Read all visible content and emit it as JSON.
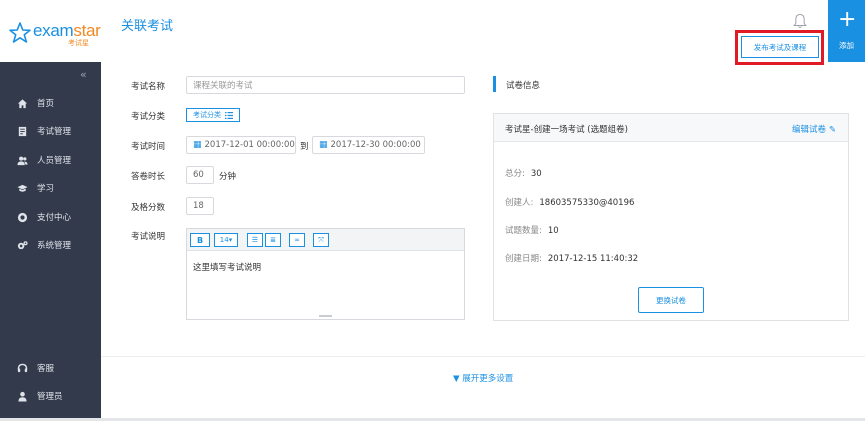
{
  "brand": {
    "name_a": "exam",
    "name_b": "star",
    "sub": "考试星"
  },
  "header": {
    "title": "关联考试",
    "publish_button": "发布考试及课程",
    "add_label": "添加",
    "add_symbol": "+"
  },
  "sidebar": {
    "collapse": "«",
    "items": [
      {
        "label": "首页",
        "icon": "home-icon"
      },
      {
        "label": "考试管理",
        "icon": "document-icon"
      },
      {
        "label": "人员管理",
        "icon": "users-icon"
      },
      {
        "label": "学习",
        "icon": "graduation-cap-icon"
      },
      {
        "label": "支付中心",
        "icon": "payment-icon"
      },
      {
        "label": "系统管理",
        "icon": "gears-icon"
      }
    ],
    "bottom": [
      {
        "label": "客服",
        "icon": "headset-icon"
      },
      {
        "label": "管理员",
        "icon": "user-icon"
      }
    ]
  },
  "form": {
    "name_label": "考试名称",
    "name_placeholder": "课程关联的考试",
    "category_label": "考试分类",
    "category_button": "考试分类",
    "time_label": "考试时间",
    "start_time": "2017-12-01 00:00:00",
    "to": "到",
    "end_time": "2017-12-30 00:00:00",
    "duration_label": "答卷时长",
    "duration_value": "60",
    "duration_unit": "分钟",
    "pass_label": "及格分数",
    "pass_value": "18",
    "desc_label": "考试说明",
    "desc_placeholder": "这里填写考试说明",
    "toolbar": {
      "bold": "B",
      "size": "14▾"
    }
  },
  "paper": {
    "section_title": "试卷信息",
    "card_title": "考试星-创建一场考试 (选题组卷)",
    "edit_link": "编辑试卷",
    "total_label": "总分:",
    "total_value": "30",
    "creator_label": "创建人:",
    "creator_value": "18603575330@40196",
    "count_label": "试题数量:",
    "count_value": "10",
    "date_label": "创建日期:",
    "date_value": "2017-12-15 11:40:32",
    "change_button": "更换试卷"
  },
  "footer": {
    "expand": "展开更多设置"
  },
  "colors": {
    "accent": "#1a90e2",
    "sidebar": "#333a4b",
    "highlight": "#e01b25",
    "brand_orange": "#f08a24"
  }
}
